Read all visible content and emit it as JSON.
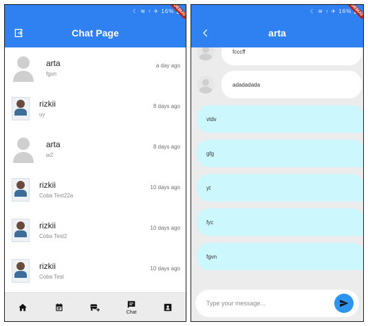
{
  "colors": {
    "primary": "#2f80f0",
    "outgoing_bubble": "#ccf7fd",
    "debug_banner": "#b3261e"
  },
  "status_bar": {
    "indicators": "☾ ≋ ↑ ✈ 16% ▮"
  },
  "debug_label": "DEBUG",
  "left": {
    "title": "Chat Page",
    "logout_icon": "logout-icon",
    "chats": [
      {
        "name": "arta",
        "preview": "fgvn",
        "time": "a day ago",
        "avatar": "default"
      },
      {
        "name": "rizkii",
        "preview": "uy",
        "time": "8 days ago",
        "avatar": "photo"
      },
      {
        "name": "arta",
        "preview": "w2",
        "time": "8 days ago",
        "avatar": "default"
      },
      {
        "name": "rizkii",
        "preview": "Coba Test22a",
        "time": "10 days ago",
        "avatar": "photo"
      },
      {
        "name": "rizkii",
        "preview": "Coba Test2",
        "time": "10 days ago",
        "avatar": "photo"
      },
      {
        "name": "rizkii",
        "preview": "Coba Test",
        "time": "10 days ago",
        "avatar": "photo"
      }
    ],
    "nav": [
      {
        "icon": "home-icon",
        "label": ""
      },
      {
        "icon": "calendar-icon",
        "label": ""
      },
      {
        "icon": "add-business-icon",
        "label": ""
      },
      {
        "icon": "chat-icon",
        "label": "Chat"
      },
      {
        "icon": "contact-icon",
        "label": ""
      }
    ]
  },
  "right": {
    "title": "arta",
    "back_icon": "back-arrow-icon",
    "incoming": [
      {
        "text": "fcccff"
      },
      {
        "text": "adadadada"
      }
    ],
    "outgoing": [
      {
        "text": "vtdv"
      },
      {
        "text": "gfg"
      },
      {
        "text": "yt"
      },
      {
        "text": "fyc"
      },
      {
        "text": "fgvn"
      }
    ],
    "composer": {
      "placeholder": "Type your message...",
      "send_icon": "send-icon"
    }
  }
}
